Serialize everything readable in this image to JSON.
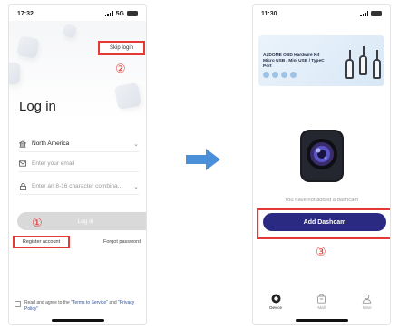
{
  "left_phone": {
    "status_time": "17:32",
    "status_network": "5G",
    "skip_login_label": "Skip login",
    "marker_skip": "②",
    "title": "Log in",
    "region_value": "North America",
    "email_placeholder": "Enter your email",
    "password_placeholder": "Enter an 8-16 character combina...",
    "login_button_label": "Log in",
    "marker_login": "①",
    "register_label": "Register account",
    "forgot_label": "Forgot password",
    "agree_prefix": "Read and agree to the",
    "terms_link": "\"Terms to Service\"",
    "agree_and": "and",
    "privacy_link": "\"Privacy Policy\""
  },
  "right_phone": {
    "status_time": "11:30",
    "banner_title": "AZDOME OBD Hardwire Kit Micro USB / Mini USB / TypeC Port",
    "no_camera_text": "You have not added a dashcam",
    "add_button_label": "Add Dashcam",
    "marker_add": "③",
    "tabs": [
      {
        "label": "Device",
        "icon": "camera-icon",
        "active": true
      },
      {
        "label": "Mall",
        "icon": "bag-icon",
        "active": false
      },
      {
        "label": "Mine",
        "icon": "person-icon",
        "active": false
      }
    ]
  },
  "colors": {
    "highlight_red": "#e53935",
    "primary_navy": "#2a2a82",
    "arrow_blue": "#4a90d9",
    "disabled_gray": "#d9d9d9"
  }
}
